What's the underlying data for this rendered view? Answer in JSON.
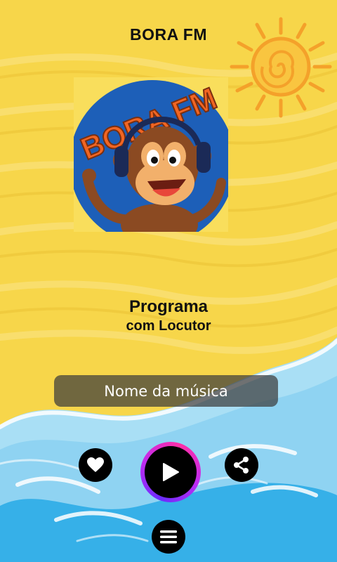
{
  "header": {
    "title": "BORA FM"
  },
  "logo": {
    "text": "BORA FM",
    "icon": "monkey-headphones-logo"
  },
  "program": {
    "title": "Programa",
    "host": "com Locutor"
  },
  "player": {
    "song_name": "Nome da música",
    "like_icon": "heart-icon",
    "play_icon": "play-icon",
    "share_icon": "share-icon",
    "menu_icon": "hamburger-menu-icon"
  },
  "colors": {
    "sand": "#f7d64a",
    "sea": "#8fd3f2",
    "deep_sea": "#36b0e8",
    "sun": "#f4a12a",
    "logo_blue": "#1d5fb8",
    "logo_orange": "#f26522",
    "monkey_brown": "#8b4a22"
  }
}
